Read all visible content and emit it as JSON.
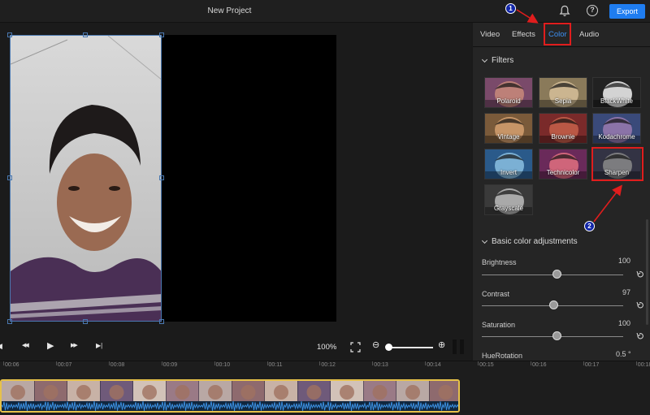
{
  "window": {
    "title": "New Project"
  },
  "toolbar": {
    "export_label": "Export",
    "help_glyph": "?",
    "bell_icon": "bell-icon"
  },
  "preview": {
    "zoom_level": "100%"
  },
  "playback": {
    "prev_glyph": "◀",
    "rewind_glyph": "◀◀",
    "play_glyph": "▶",
    "forward_glyph": "▶▶",
    "next_glyph": "▶|",
    "zoom_out_glyph": "⊖",
    "zoom_in_glyph": "⊕",
    "zoom_fraction": 0.05
  },
  "panel": {
    "tabs": [
      {
        "label": "Video"
      },
      {
        "label": "Effects"
      },
      {
        "label": "Color"
      },
      {
        "label": "Audio"
      }
    ],
    "active_tab": "Color",
    "filters_heading": "Filters",
    "filters": [
      {
        "label": "Polaroid"
      },
      {
        "label": "Sepia"
      },
      {
        "label": "BlackWhite"
      },
      {
        "label": "Vintage"
      },
      {
        "label": "Brownie"
      },
      {
        "label": "Kodachrome"
      },
      {
        "label": "Invert"
      },
      {
        "label": "Technicolor"
      },
      {
        "label": "Sharpen"
      },
      {
        "label": "Grayscale"
      }
    ],
    "adjust_heading": "Basic color adjustments",
    "adjustments": [
      {
        "label": "Brightness",
        "value": "100",
        "fraction": 0.53
      },
      {
        "label": "Contrast",
        "value": "97",
        "fraction": 0.51
      },
      {
        "label": "Saturation",
        "value": "100",
        "fraction": 0.53
      },
      {
        "label": "HueRotation",
        "value": "0.5 °"
      }
    ]
  },
  "timeline": {
    "ticks": [
      "00:06",
      "00:07",
      "00:08",
      "00:09",
      "00:10",
      "00:11",
      "00:12",
      "00:13",
      "00:14",
      "00:15",
      "00:16",
      "00:17",
      "00:18"
    ]
  },
  "annotations": {
    "step1": "1",
    "step2": "2"
  },
  "colors": {
    "accent": "#1f7df0",
    "active_tab": "#3d8ef0",
    "highlight": "#e01d1d",
    "clip_border": "#e6c14a",
    "badge": "#1226a8"
  }
}
